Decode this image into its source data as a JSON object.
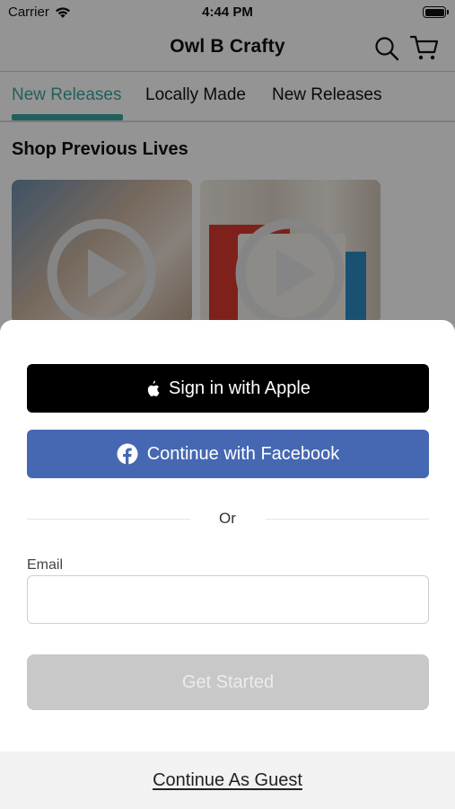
{
  "status_bar": {
    "carrier": "Carrier",
    "time": "4:44 PM"
  },
  "header": {
    "title": "Owl B Crafty",
    "search_icon": "search-icon",
    "cart_icon": "cart-icon"
  },
  "tabs": [
    {
      "label": "New Releases",
      "active": true
    },
    {
      "label": "Locally Made",
      "active": false
    },
    {
      "label": "New Releases",
      "active": false
    }
  ],
  "section": {
    "title": "Shop Previous Lives"
  },
  "videos": [
    {
      "icon": "play-icon"
    },
    {
      "icon": "play-icon"
    }
  ],
  "sign_in": {
    "apple_label": "Sign in with Apple",
    "facebook_label": "Continue with Facebook",
    "or_label": "Or",
    "email_label": "Email",
    "email_value": "",
    "email_placeholder": "",
    "get_started_label": "Get Started",
    "guest_label": "Continue As Guest"
  },
  "colors": {
    "accent": "#3aa6a0",
    "facebook": "#4668b3",
    "apple": "#000000",
    "disabled_button": "#c8c8c8"
  }
}
